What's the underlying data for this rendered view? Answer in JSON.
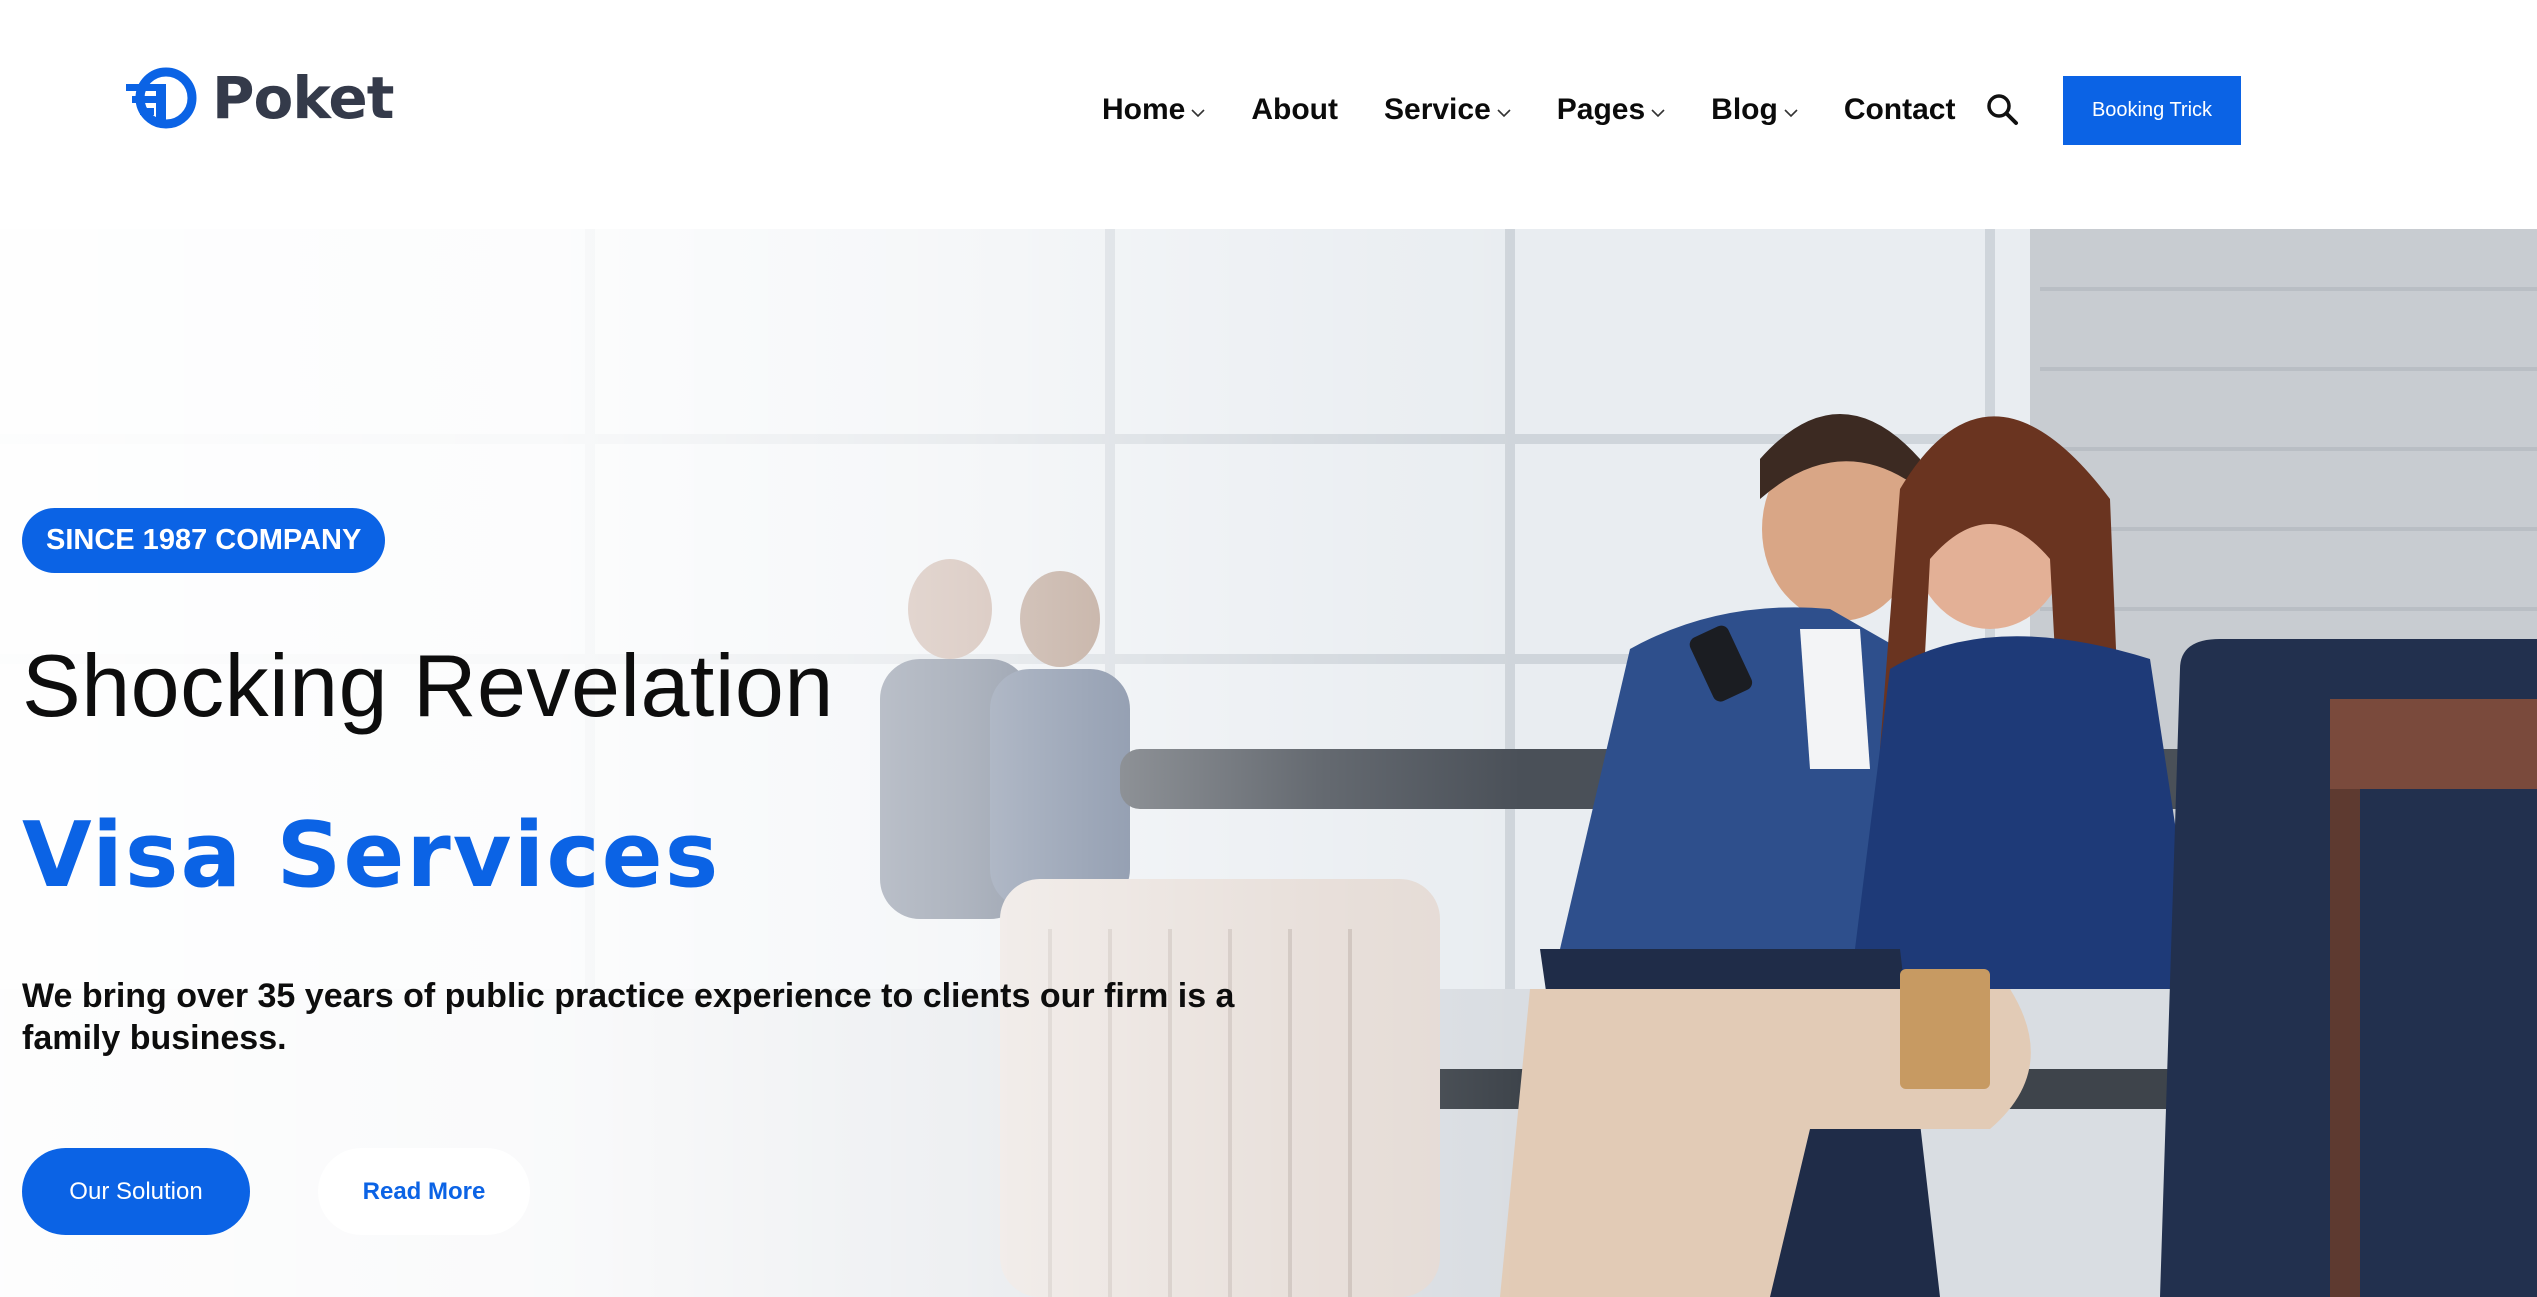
{
  "brand": {
    "name": "Poket",
    "accent": "#0b63e5",
    "logo_icon": "poket-logo-icon"
  },
  "nav": {
    "items": [
      {
        "label": "Home",
        "has_dropdown": true
      },
      {
        "label": "About",
        "has_dropdown": false
      },
      {
        "label": "Service",
        "has_dropdown": true
      },
      {
        "label": "Pages",
        "has_dropdown": true
      },
      {
        "label": "Blog",
        "has_dropdown": true
      },
      {
        "label": "Contact",
        "has_dropdown": false
      }
    ],
    "search_icon": "search-icon",
    "cta_label": "Booking Trick"
  },
  "hero": {
    "badge": "SINCE 1987 COMPANY",
    "headline_line1": "Shocking Revelation",
    "headline_line2": "Visa Services",
    "description": "We bring over 35 years of public practice experience to clients our firm is a family business.",
    "primary_button": "Our Solution",
    "secondary_button": "Read More",
    "image_subject": "hero-photo-couple-at-airport"
  }
}
